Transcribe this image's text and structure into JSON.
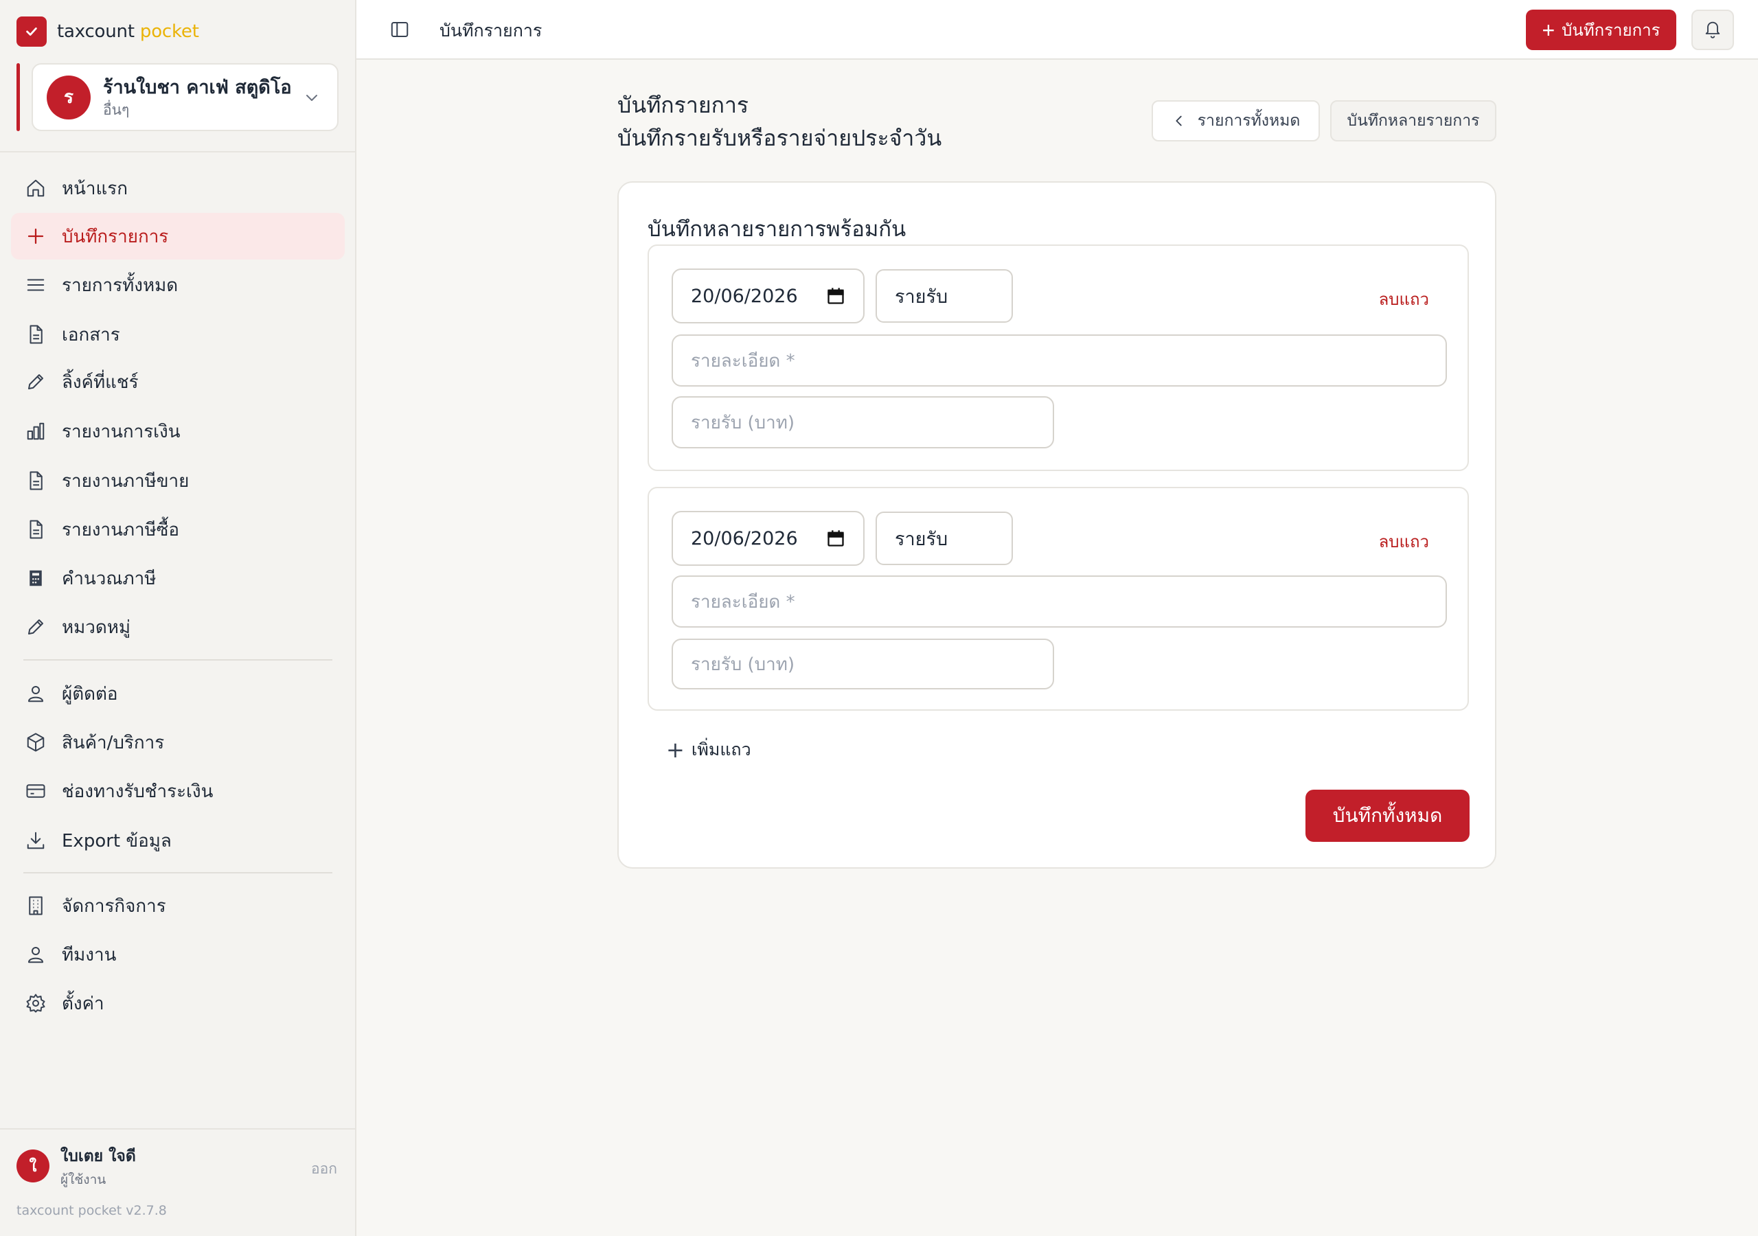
{
  "brand": {
    "name": "taxcount",
    "accent": "pocket",
    "color": "#c21f2a",
    "accent_color": "#eab308"
  },
  "org": {
    "initial": "ร",
    "name": "ร้านใบชา คาเฟ่ สตูดิโอ",
    "category": "อื่นๆ"
  },
  "nav": {
    "home": "หน้าแรก",
    "record": "บันทึกรายการ",
    "all_items": "รายการทั้งหมด",
    "documents": "เอกสาร",
    "shared_links": "ลิ้งค์ที่แชร์",
    "financial_report": "รายงานการเงิน",
    "sales_tax_report": "รายงานภาษีขาย",
    "purchase_tax_report": "รายงานภาษีซื้อ",
    "tax_calc": "คำนวณภาษี",
    "categories": "หมวดหมู่",
    "contacts": "ผู้ติดต่อ",
    "products": "สินค้า/บริการ",
    "payment_channels": "ช่องทางรับชำระเงิน",
    "export": "Export ข้อมูล",
    "business": "จัดการกิจการ",
    "team": "ทีมงาน",
    "settings": "ตั้งค่า"
  },
  "user": {
    "initial": "ใ",
    "name": "ใบเตย ใจดี",
    "role": "ผู้ใช้งาน",
    "logout": "ออก"
  },
  "version": "taxcount pocket v2.7.8",
  "topbar": {
    "title": "บันทึกรายการ",
    "new_button": "บันทึกรายการ"
  },
  "page": {
    "title": "บันทึกรายการ",
    "subtitle": "บันทึกรายรับหรือรายจ่ายประจำวัน",
    "back_button": "รายการทั้งหมด",
    "multi_button": "บันทึกหลายรายการ"
  },
  "form": {
    "title": "บันทึกหลายรายการพร้อมกัน",
    "rows": [
      {
        "date": "20/06/2026",
        "type": "รายรับ",
        "delete": "ลบแถว",
        "detail_placeholder": "รายละเอียด *",
        "amount_placeholder": "รายรับ (บาท)"
      },
      {
        "date": "20/06/2026",
        "type": "รายรับ",
        "delete": "ลบแถว",
        "detail_placeholder": "รายละเอียด *",
        "amount_placeholder": "รายรับ (บาท)"
      }
    ],
    "add_row": "เพิ่มแถว",
    "save_all": "บันทึกทั้งหมด"
  }
}
